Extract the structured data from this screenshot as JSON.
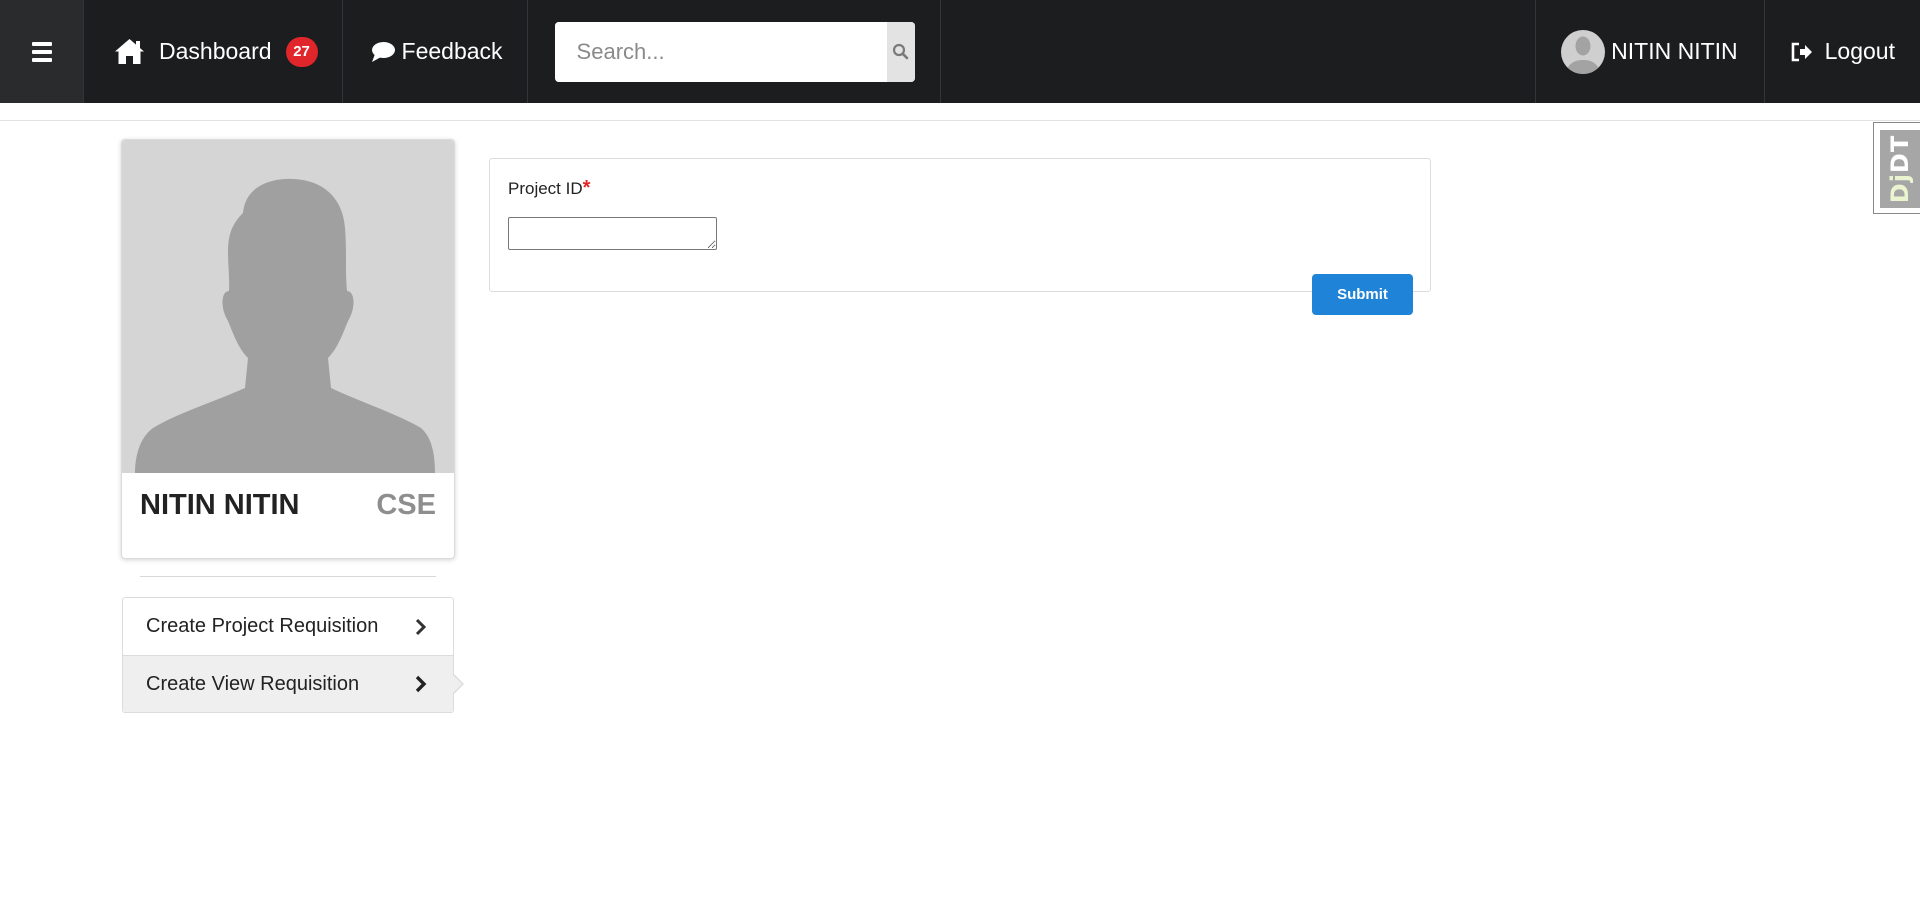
{
  "navbar": {
    "dashboard_label": "Dashboard",
    "notification_count": "27",
    "feedback_label": "Feedback",
    "search_placeholder": "Search...",
    "search_value": "",
    "user_name": "NITIN NITIN",
    "logout_label": "Logout",
    "background_color": "#1c1d1f",
    "badge_color": "#e0262b"
  },
  "profile": {
    "name": "NITIN NITIN",
    "department": "CSE"
  },
  "side_menu": {
    "items": [
      {
        "label": "Create Project Requisition",
        "active": false
      },
      {
        "label": "Create View Requisition",
        "active": true
      }
    ]
  },
  "form": {
    "project_id_label": "Project ID",
    "required_marker": "*",
    "project_id_value": "",
    "submit_label": "Submit",
    "submit_color": "#1f83d8"
  },
  "debug_toolbar": {
    "prefix": "Dj",
    "suffix": "DT"
  },
  "icons": {
    "menu": "hamburger-icon",
    "dashboard": "home-icon",
    "feedback": "speech-bubble-icon",
    "search": "search-icon",
    "logout": "sign-out-icon",
    "menu_item": "chevron-right-icon"
  }
}
